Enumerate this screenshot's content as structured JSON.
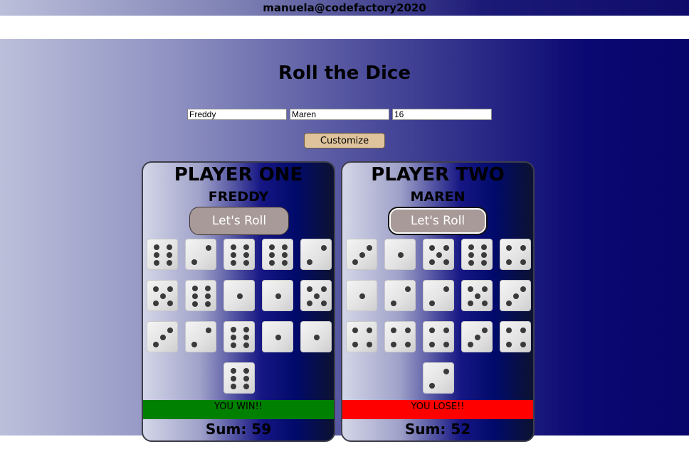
{
  "header": {
    "user": "manuela@codefactory2020"
  },
  "page": {
    "title": "Roll the Dice"
  },
  "form": {
    "name1": "Freddy",
    "name2": "Maren",
    "count": "16",
    "customize_label": "Customize"
  },
  "players": [
    {
      "heading": "PLAYER ONE",
      "name": "FREDDY",
      "roll_label": "Let's Roll",
      "dice": [
        6,
        2,
        6,
        6,
        2,
        5,
        6,
        1,
        1,
        5,
        3,
        2,
        6,
        1,
        1,
        6
      ],
      "result": "YOU WIN!!",
      "result_color": "#008000",
      "sum": "Sum: 59"
    },
    {
      "heading": "PLAYER TWO",
      "name": "MAREN",
      "roll_label": "Let's Roll",
      "dice": [
        3,
        1,
        5,
        6,
        4,
        1,
        2,
        2,
        5,
        3,
        4,
        4,
        4,
        3,
        4,
        2
      ],
      "result": "YOU LOSE!!",
      "result_color": "#ff0000",
      "sum": "Sum: 52"
    }
  ]
}
